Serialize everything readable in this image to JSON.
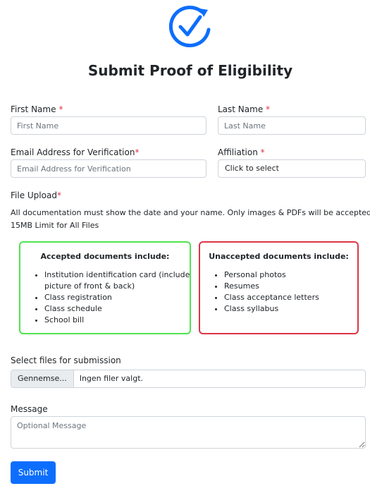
{
  "page": {
    "title": "Submit Proof of Eligibility",
    "logo_icon": "circular-check-icon",
    "accent_color": "#0d6efd"
  },
  "form": {
    "first_name": {
      "label": "First Name",
      "required": "*",
      "placeholder": "First Name",
      "value": ""
    },
    "last_name": {
      "label": "Last Name",
      "required": "*",
      "placeholder": "Last Name",
      "value": ""
    },
    "email": {
      "label": "Email Address for Verification",
      "required": "*",
      "placeholder": "Email Address for Verification",
      "value": ""
    },
    "affiliation": {
      "label": "Affiliation",
      "required": "*",
      "selected": "Click to select"
    },
    "file_upload": {
      "label": "File Upload",
      "required": "*",
      "note": "All documentation must show the date and your name. Only images & PDFs will be accepted",
      "limit": "15MB Limit for  All Files"
    },
    "accepted": {
      "title": "Accepted documents include:",
      "border_color": "#4ee44e",
      "items": [
        "Institution identification card (include",
        "picture of front & back)",
        "Class registration",
        "Class schedule",
        "School bill"
      ]
    },
    "unaccepted": {
      "title": "Unaccepted documents include:",
      "border_color": "#dc3545",
      "items": [
        "Personal photos",
        "Resumes",
        "Class acceptance letters",
        "Class syllabus"
      ]
    },
    "select_files": {
      "label": "Select files for submission",
      "button_label": "Gennemse...",
      "status": "Ingen filer valgt."
    },
    "message": {
      "label": "Message",
      "placeholder": "Optional Message",
      "value": ""
    },
    "submit_label": "Submit"
  }
}
